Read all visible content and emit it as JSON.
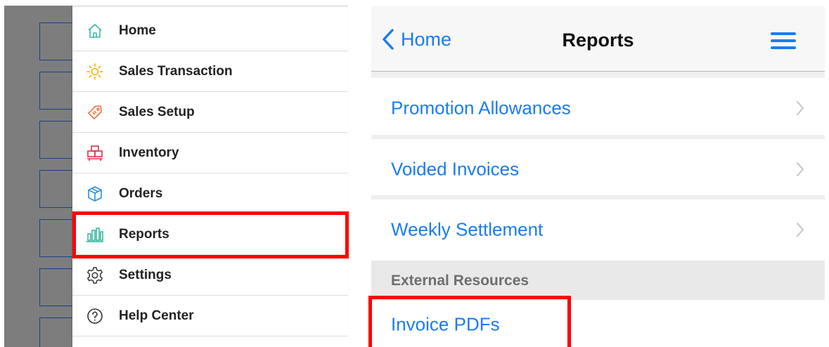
{
  "left_menu": {
    "items": [
      {
        "label": "Home",
        "icon": "home-icon",
        "color": "#3cb8a8"
      },
      {
        "label": "Sales Transaction",
        "icon": "sun-icon",
        "color": "#f0b400"
      },
      {
        "label": "Sales Setup",
        "icon": "tag-icon",
        "color": "#f07040"
      },
      {
        "label": "Inventory",
        "icon": "boxes-icon",
        "color": "#e0304a"
      },
      {
        "label": "Orders",
        "icon": "package-icon",
        "color": "#2a90d8"
      },
      {
        "label": "Reports",
        "icon": "bar-chart-icon",
        "color": "#2bb39a",
        "highlighted": true
      },
      {
        "label": "Settings",
        "icon": "gear-icon",
        "color": "#333333"
      },
      {
        "label": "Help Center",
        "icon": "question-circle-icon",
        "color": "#333333"
      }
    ]
  },
  "reports_screen": {
    "nav": {
      "back_label": "Home",
      "title": "Reports",
      "menu_icon": "hamburger-icon"
    },
    "rows": [
      {
        "label": "Promotion Allowances"
      },
      {
        "label": "Voided Invoices"
      },
      {
        "label": "Weekly Settlement"
      }
    ],
    "section_header": "External Resources",
    "external_rows": [
      {
        "label": "Invoice PDFs",
        "highlighted": true
      }
    ]
  },
  "colors": {
    "accent": "#1a7cf0",
    "highlight": "#ff0000"
  }
}
